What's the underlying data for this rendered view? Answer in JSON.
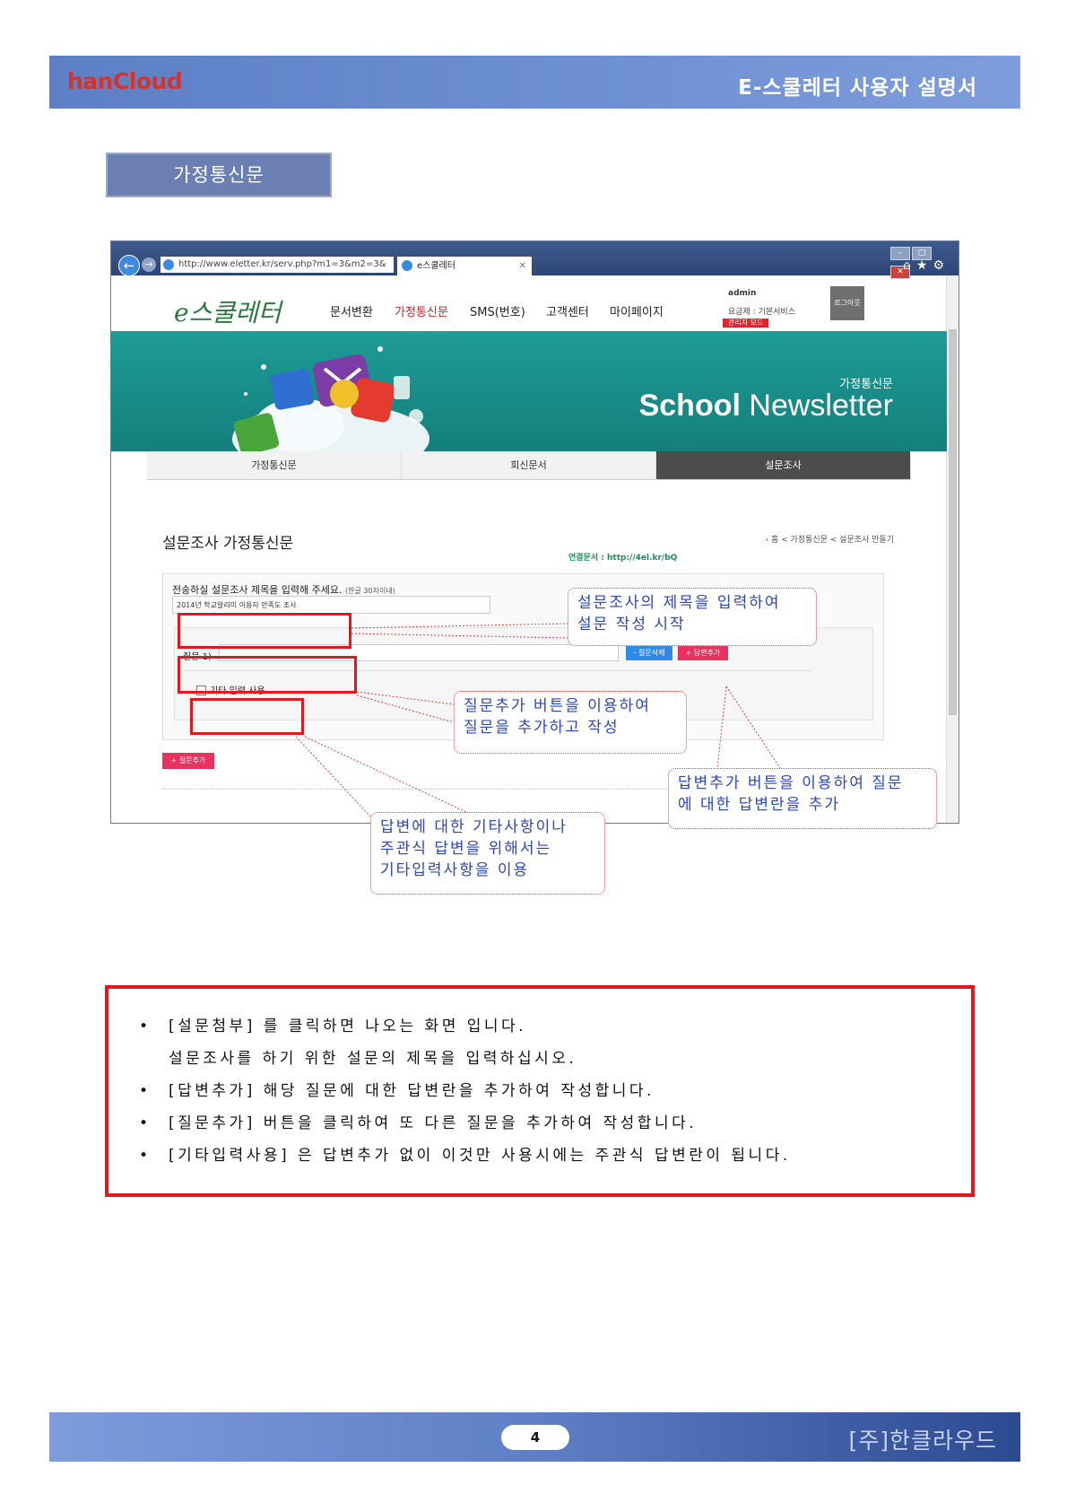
{
  "header": {
    "logo": "hanCloud",
    "title": "E-스쿨레터 사용자 설명서"
  },
  "section_title": "가정통신문",
  "browser": {
    "url": "http://www.eletter.kr/serv.php?m1=3&m2=3&",
    "tab_title": "e스쿨레터",
    "site": {
      "logo": "e스쿨레터",
      "menu": [
        "문서변환",
        "가정통신문",
        "SMS(번호)",
        "고객센터",
        "마이페이지"
      ],
      "active_menu": "가정통신문",
      "admin_name": "admin",
      "plan": "요금제 : 기본서비스",
      "admin_mode": "관리자 모드",
      "logout": "로그아웃",
      "banner_sub": "가정통신문",
      "banner_title_bold": "School",
      "banner_title_rest": " Newsletter",
      "tabs": [
        "가정통신문",
        "회신문서",
        "설문조사"
      ],
      "active_tab": "설문조사",
      "page_heading": "설문조사 가정통신문",
      "breadcrumb": "› 홈 < 가정통신문 < 설문조사 만들기",
      "link_doc": "연결문서 : http://4el.kr/bQ",
      "form_label": "전송하실 설문조사 제목을 입력해 주세요.",
      "form_label_hint": "(한글 30자이내)",
      "title_value": "2014년 학교알리미 이용자 만족도 조사",
      "question_label": "질문 1)",
      "btn_delete_question": "- 질문삭제",
      "btn_add_answer": "+ 답변추가",
      "etc_label": "기타 입력 사용",
      "btn_add_question": "+ 질문추가"
    }
  },
  "callouts": {
    "c1": [
      "설문조사의 제목을 입력하여",
      "설문 작성 시작"
    ],
    "c2": [
      "질문추가 버튼을 이용하여",
      "질문을 추가하고 작성"
    ],
    "c3": [
      "답변추가 버튼을 이용하여 질문",
      "에 대한 답변란을 추가"
    ],
    "c4": [
      "답변에 대한 기타사항이나",
      "주관식 답변을 위해서는",
      "기타입력사항을 이용"
    ]
  },
  "notes": [
    "[설문첨부] 를 클릭하면 나오는 화면 입니다.",
    "설문조사를 하기 위한 설문의 제목을 입력하십시오.",
    "[답변추가] 해당 질문에 대한 답변란을 추가하여 작성합니다.",
    "[질문추가] 버튼을 클릭하여 또 다른 질문을 추가하여 작성합니다.",
    "[기타입력사용] 은 답변추가 없이 이것만 사용시에는 주관식 답변란이 됩니다."
  ],
  "footer": {
    "page_number": "4",
    "company": "[주]한클라우드"
  },
  "colors": {
    "header_blue": "#6f90d4",
    "highlight_red": "#e5171e",
    "callout_text": "#2a45c6",
    "banner_teal": "#1e9c97"
  }
}
